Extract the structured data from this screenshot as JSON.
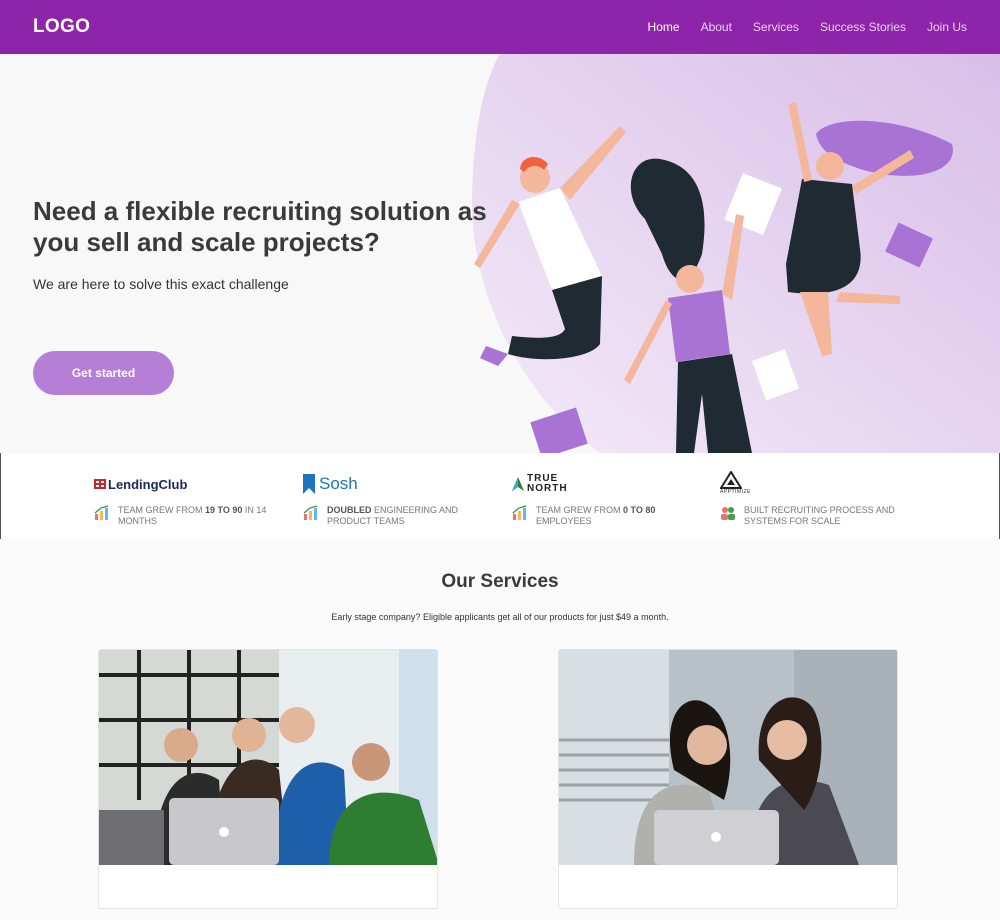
{
  "nav": {
    "logo": "LOGO",
    "links": [
      "Home",
      "About",
      "Services",
      "Success Stories",
      "Join Us"
    ]
  },
  "hero": {
    "title": "Need a flexible recruiting solution as you sell and scale projects?",
    "subtitle": "We are here to solve this exact challenge",
    "cta": "Get started"
  },
  "proof": [
    {
      "company": "LendingClub",
      "stat_pre": "TEAM GREW FROM ",
      "stat_bold": "19 TO 90",
      "stat_post": " IN 14 MONTHS"
    },
    {
      "company": "Sosh",
      "stat_pre": "",
      "stat_bold": "DOUBLED",
      "stat_post": " ENGINEERING AND PRODUCT TEAMS"
    },
    {
      "company": "TRUE NORTH",
      "stat_pre": "TEAM GREW FROM ",
      "stat_bold": "0 TO 80",
      "stat_post": " EMPLOYEES"
    },
    {
      "company": "APPTIMIZE",
      "stat_pre": "BUILT RECRUITING PROCESS AND SYSTEMS FOR SCALE",
      "stat_bold": "",
      "stat_post": ""
    }
  ],
  "services": {
    "title": "Our Services",
    "subtitle": "Early stage company? Eligible applicants get all of our products for just $49 a month."
  },
  "colors": {
    "brand": "#8e24aa",
    "accent": "#b57fd8"
  }
}
